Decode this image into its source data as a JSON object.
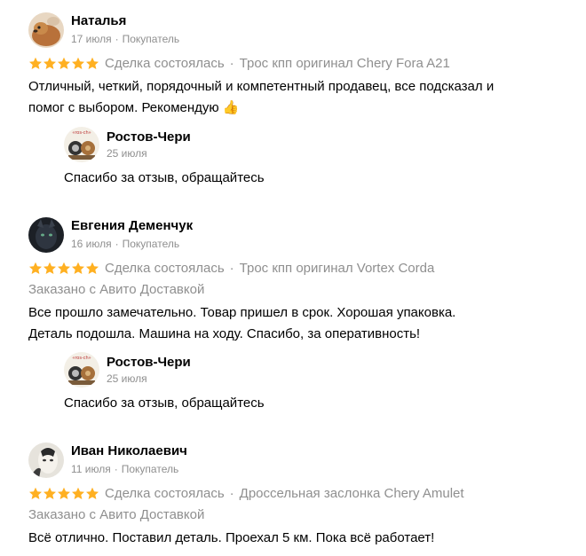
{
  "reviews": [
    {
      "author": "Наталья",
      "date": "17 июля",
      "role": "Покупатель",
      "rating": 5,
      "deal_status": "Сделка состоялась",
      "item": "Трос кпп оригинал Chery Fora A21",
      "delivery": "",
      "text_lines": [
        "Отличный, четкий, порядочный и компетентный продавец, все подсказал и",
        "помог с выбором. Рекомендую 👍"
      ],
      "reply": {
        "author": "Ростов-Чери",
        "date": "25 июля",
        "text": "Спасибо за отзыв, обращайтесь"
      }
    },
    {
      "author": "Евгения Деменчук",
      "date": "16 июля",
      "role": "Покупатель",
      "rating": 5,
      "deal_status": "Сделка состоялась",
      "item": "Трос кпп оригинал Vortex Corda",
      "delivery": "Заказано с Авито Доставкой",
      "text_lines": [
        "Все прошло замечательно. Товар пришел в срок. Хорошая упаковка.",
        "Деталь подошла. Машина на ходу. Спасибо, за оперативность!"
      ],
      "reply": {
        "author": "Ростов-Чери",
        "date": "25 июля",
        "text": "Спасибо за отзыв, обращайтесь"
      }
    },
    {
      "author": "Иван Николаевич",
      "date": "11 июля",
      "role": "Покупатель",
      "rating": 5,
      "deal_status": "Сделка состоялась",
      "item": "Дроссельная заслонка Chery Amulet",
      "delivery": "Заказано с Авито Доставкой",
      "text_lines": [
        "Всё отлично. Поставил деталь. Проехал 5 км. Пока всё работает!"
      ]
    }
  ],
  "colors": {
    "star": "#ffb021",
    "muted": "#8f8f8f",
    "text": "#000000"
  },
  "icons": {
    "star": "star-icon",
    "separator": "·"
  }
}
